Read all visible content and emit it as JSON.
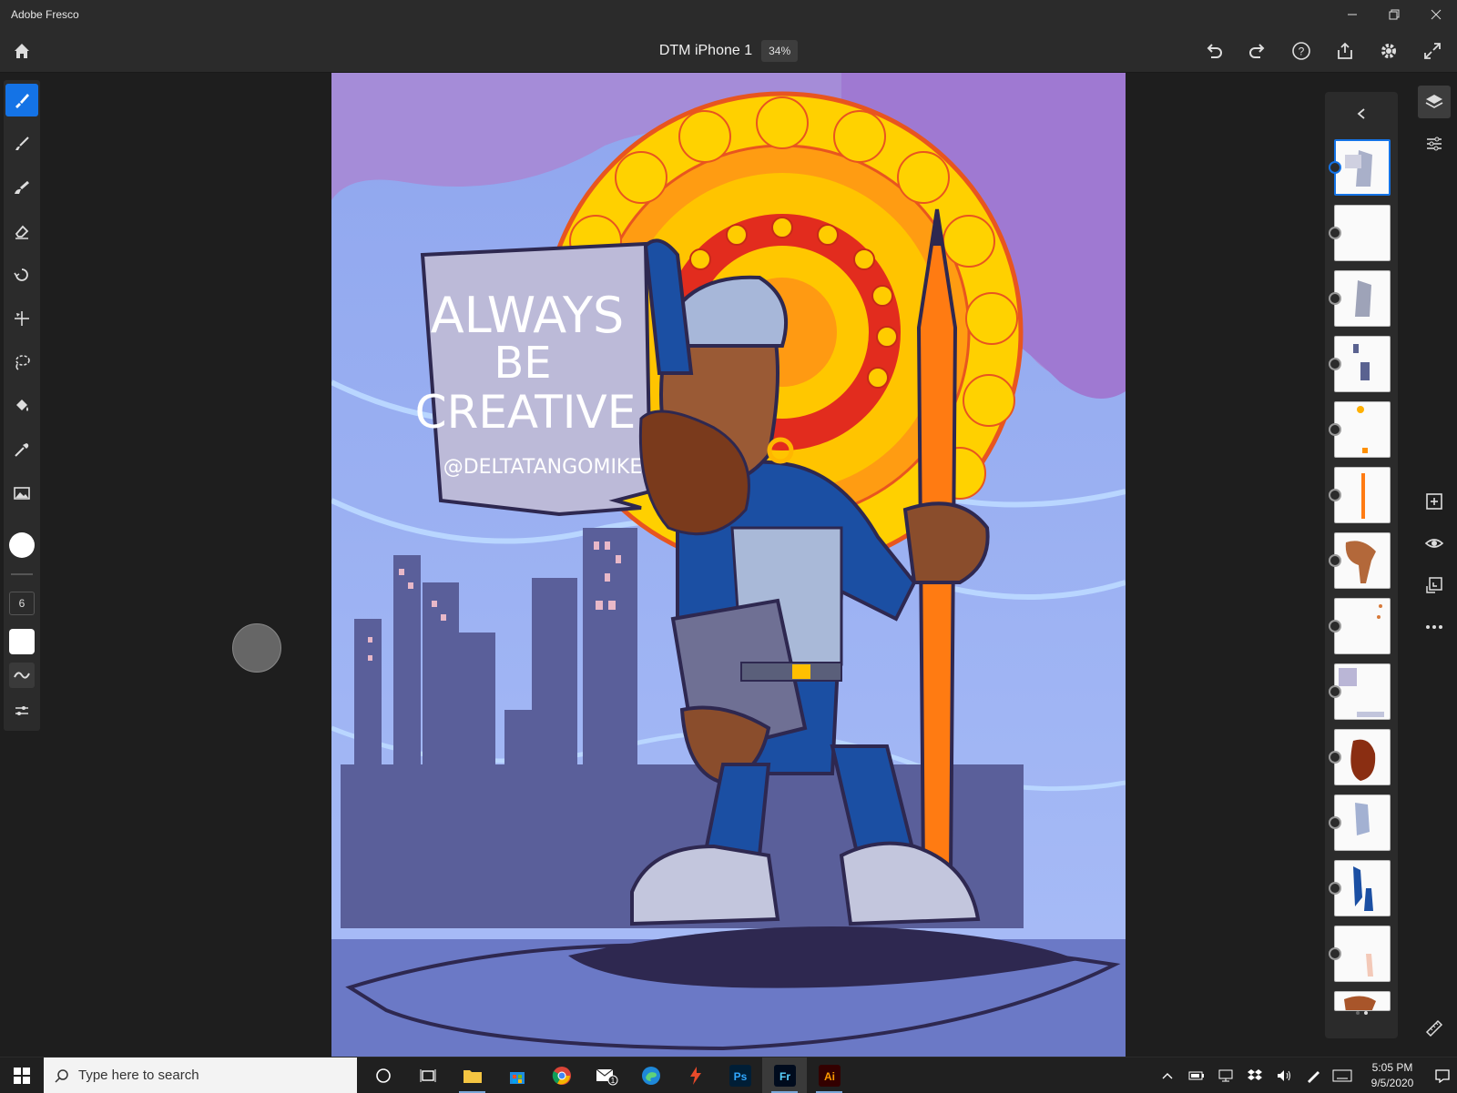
{
  "window": {
    "title": "Adobe Fresco"
  },
  "document": {
    "name": "DTM iPhone 1",
    "zoom": "34%"
  },
  "brush": {
    "size": "6"
  },
  "canvas_art": {
    "sign_lines": [
      "ALWAYS",
      "BE",
      "CREATIVE"
    ],
    "handle": "@DELTATANGOMIKE"
  },
  "taskbar": {
    "search_placeholder": "Type here to search",
    "time": "5:05 PM",
    "date": "9/5/2020",
    "apps": {
      "ps": "Ps",
      "fr": "Fr",
      "ai": "Ai"
    },
    "mail_badge": "1"
  },
  "colors": {
    "accent": "#1473e6",
    "panel": "#2b2b2b",
    "workspace": "#1e1e1e"
  }
}
